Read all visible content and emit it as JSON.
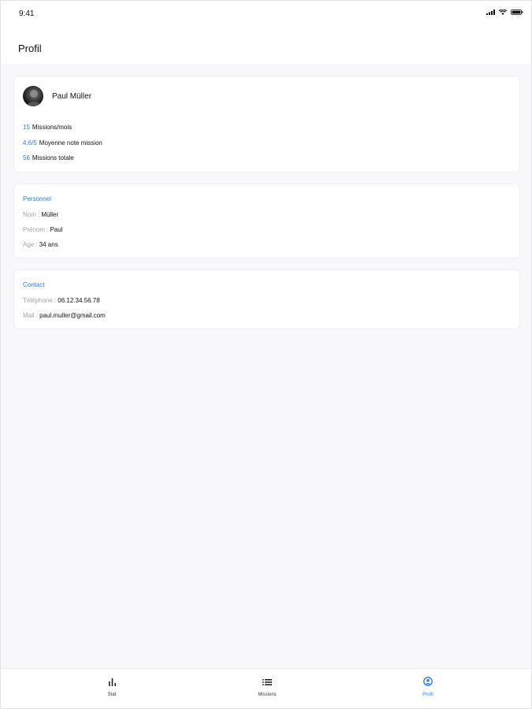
{
  "status_bar": {
    "time": "9:41"
  },
  "header": {
    "title": "Profil"
  },
  "profile": {
    "name": "Paul Müller",
    "stats": [
      {
        "value": "15",
        "label": "Missions/mois"
      },
      {
        "value": "4,6/5",
        "label": "Moyenne note mission"
      },
      {
        "value": "56",
        "label": "Missions totale"
      }
    ]
  },
  "personal": {
    "title": "Personnel",
    "fields": [
      {
        "label": "Nom :",
        "value": "Müller"
      },
      {
        "label": "Prénom :",
        "value": "Paul"
      },
      {
        "label": "Age :",
        "value": "34 ans"
      }
    ]
  },
  "contact": {
    "title": "Contact",
    "fields": [
      {
        "label": "Téléphone :",
        "value": "06.12.34.56.78"
      },
      {
        "label": "Mail :",
        "value": "paul.muller@gmail.com"
      }
    ]
  },
  "tabbar": {
    "items": [
      {
        "label": "Stat",
        "icon": "bar-chart-icon"
      },
      {
        "label": "Missions",
        "icon": "list-icon"
      },
      {
        "label": "Profil",
        "icon": "profile-icon",
        "active": true
      }
    ]
  },
  "colors": {
    "accent": "#2f7bf5",
    "background": "#f8f8fa",
    "card": "#ffffff",
    "muted": "#a2a2a8"
  }
}
